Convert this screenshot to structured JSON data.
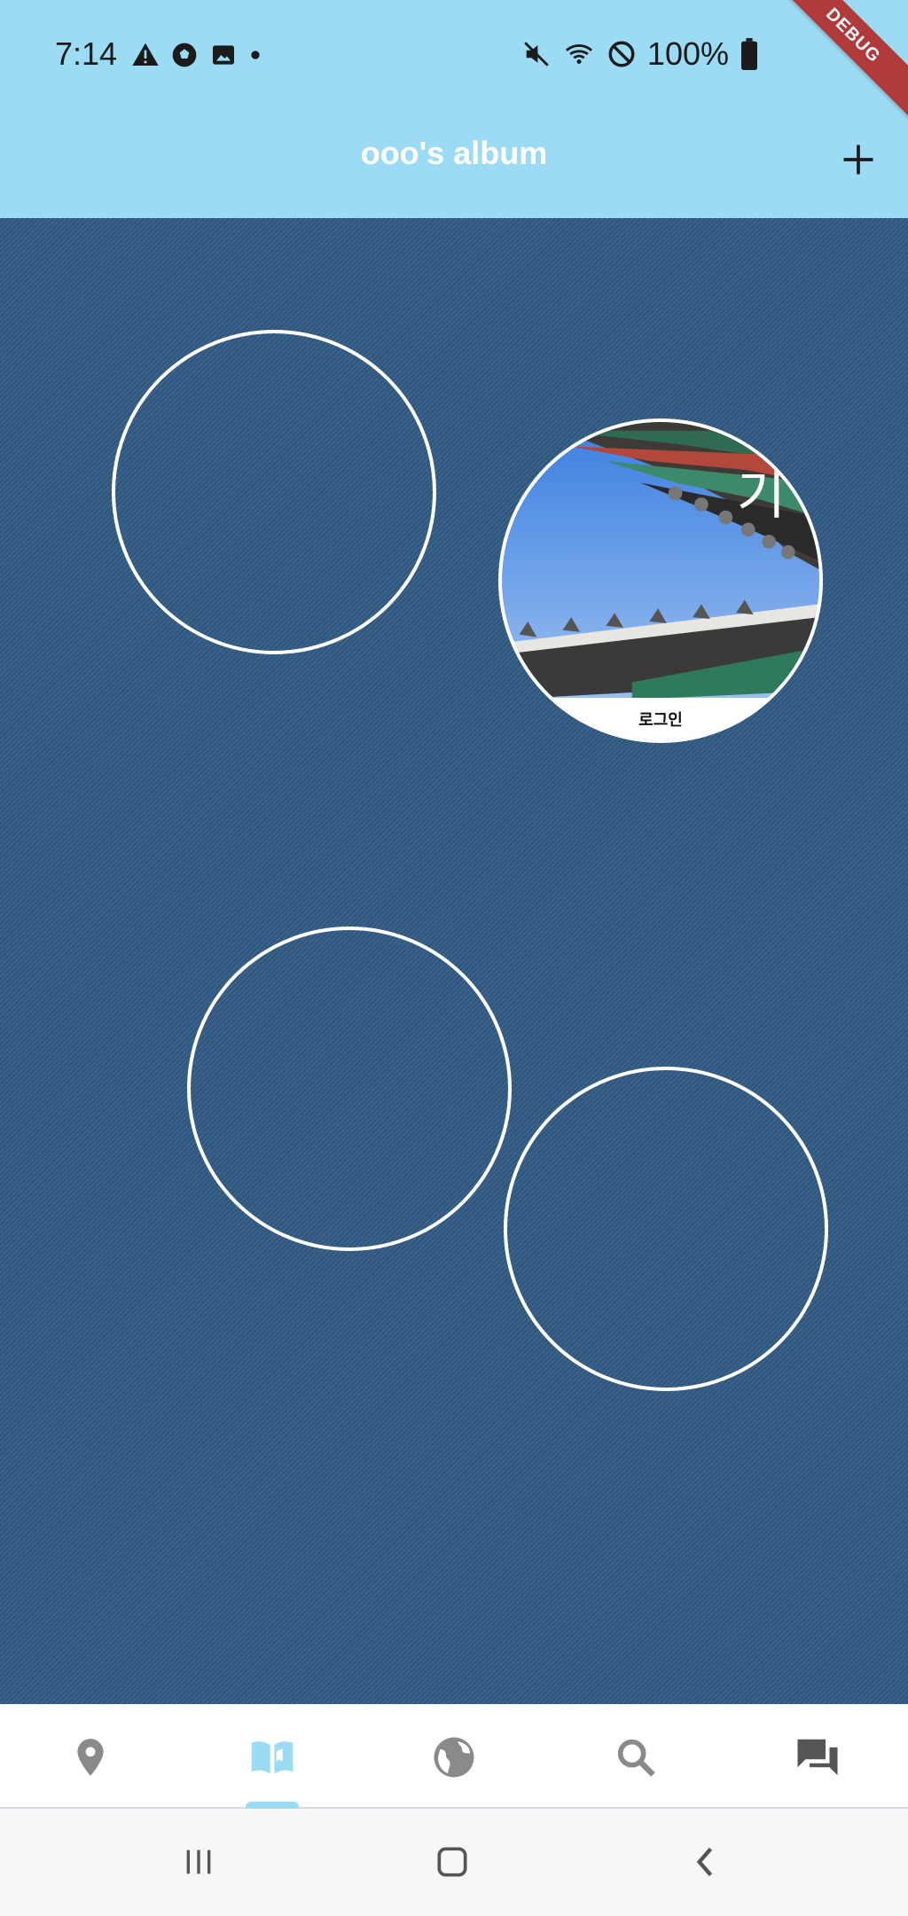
{
  "status_bar": {
    "time": "7:14",
    "battery": "100%"
  },
  "appbar": {
    "title": "ooo's album",
    "add_icon": "plus-icon"
  },
  "debug_banner": "DEBUG",
  "circles": {
    "photo_caption": "로그인",
    "photo_overlay_text": "기"
  },
  "bottom_nav": {
    "items": [
      "location-pin-icon",
      "book-icon",
      "globe-icon",
      "search-icon",
      "chat-icon"
    ],
    "selected_index": 1,
    "accent_color": "#9bdcf4"
  },
  "system_nav": [
    "recent-apps-icon",
    "home-icon",
    "back-icon"
  ]
}
